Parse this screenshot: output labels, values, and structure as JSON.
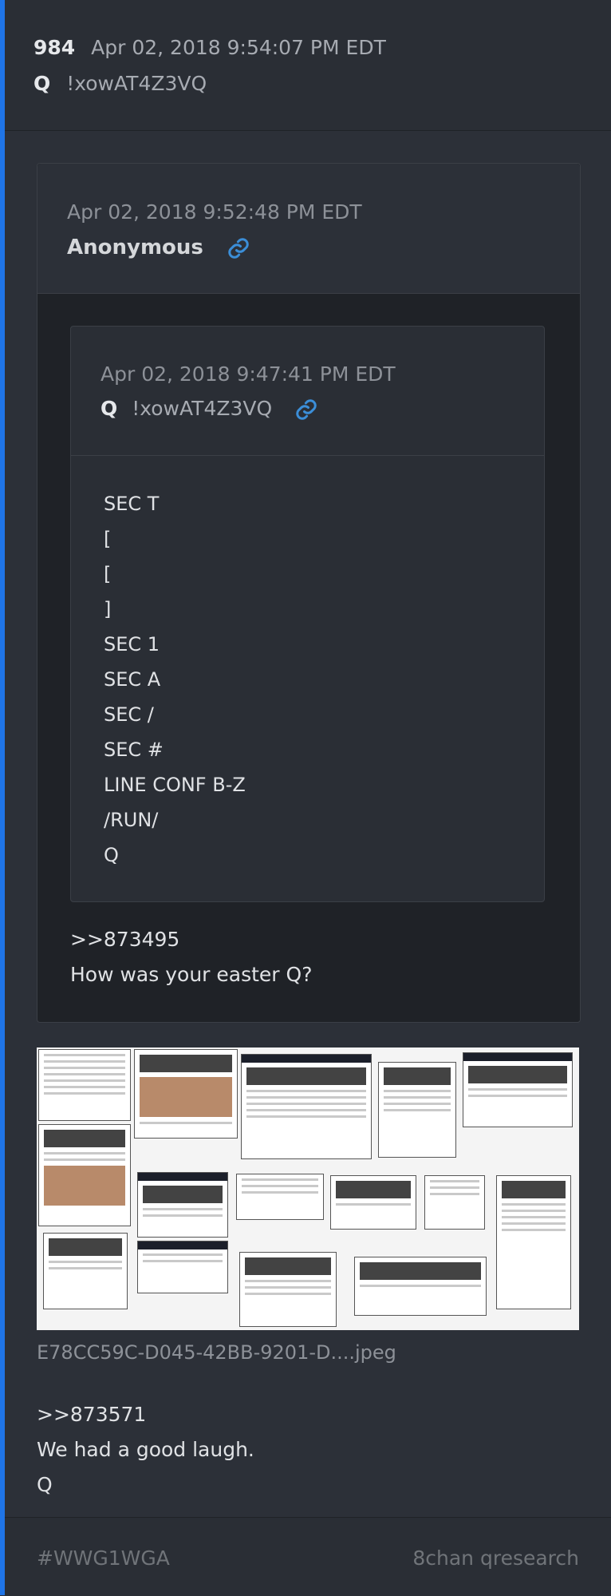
{
  "post": {
    "number": "984",
    "timestamp": "Apr 02, 2018 9:54:07 PM EDT",
    "author_badge": "Q",
    "tripcode": "!xowAT4Z3VQ"
  },
  "quote_anon": {
    "timestamp": "Apr 02, 2018 9:52:48 PM EDT",
    "author": "Anonymous",
    "reply_lines": [
      ">>873495",
      "How was your easter Q?"
    ]
  },
  "quote_q": {
    "timestamp": "Apr 02, 2018 9:47:41 PM EDT",
    "author_badge": "Q",
    "tripcode": "!xowAT4Z3VQ",
    "lines": [
      "SEC T",
      "[",
      "[",
      "]",
      "SEC 1",
      "SEC A",
      "SEC /",
      "SEC #",
      "LINE CONF B-Z",
      "/RUN/",
      "Q"
    ]
  },
  "attachment": {
    "filename": "E78CC59C-D045-42BB-9201-D....jpeg"
  },
  "reply_lines": [
    ">>873571",
    "We had a good laugh.",
    "Q"
  ],
  "footer": {
    "hashtag": "#WWG1WGA",
    "source": "8chan qresearch"
  },
  "colors": {
    "accent": "#1f74e6",
    "link_icon": "#3b8ed8",
    "background": "#2c3038"
  },
  "icons": [
    "link-icon"
  ]
}
